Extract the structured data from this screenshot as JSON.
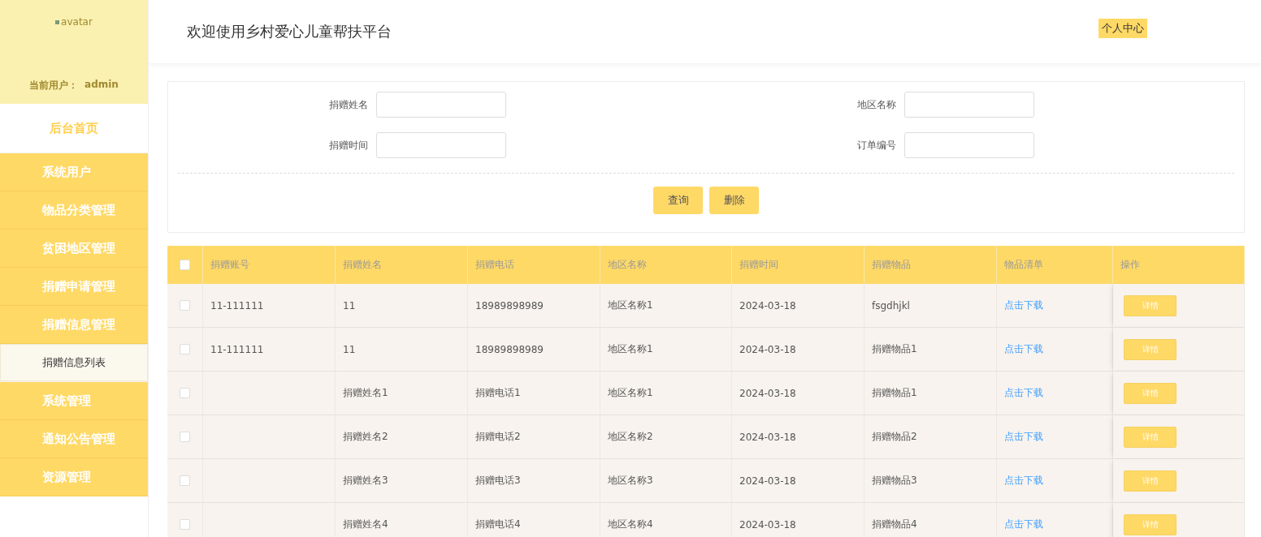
{
  "sidebar": {
    "avatar_alt": "avatar",
    "user_label": "当前用户：",
    "user_name": "admin",
    "items": [
      {
        "kind": "home",
        "label": "后台首页",
        "selected": false
      },
      {
        "kind": "menu",
        "label": "系统用户",
        "selected": false
      },
      {
        "kind": "menu",
        "label": "物品分类管理",
        "selected": false
      },
      {
        "kind": "menu",
        "label": "贫困地区管理",
        "selected": false
      },
      {
        "kind": "menu",
        "label": "捐赠申请管理",
        "selected": false
      },
      {
        "kind": "menu",
        "label": "捐赠信息管理",
        "selected": false
      },
      {
        "kind": "sub",
        "label": "捐赠信息列表",
        "selected": true
      },
      {
        "kind": "menu",
        "label": "系统管理",
        "selected": false
      },
      {
        "kind": "menu",
        "label": "通知公告管理",
        "selected": false
      },
      {
        "kind": "menu",
        "label": "资源管理",
        "selected": false
      }
    ]
  },
  "header": {
    "title": "欢迎使用乡村爱心儿童帮扶平台",
    "profile_button": "个人中心"
  },
  "filters": [
    {
      "label": "捐赠姓名"
    },
    {
      "label": "地区名称"
    },
    {
      "label": "捐赠时间"
    },
    {
      "label": "订单编号"
    }
  ],
  "actions": [
    "查询",
    "删除"
  ],
  "table": {
    "select_all_checked": false,
    "columns": [
      "捐赠账号",
      "捐赠姓名",
      "捐赠电话",
      "地区名称",
      "捐赠时间",
      "捐赠物品",
      "物品清单",
      "操作"
    ],
    "rows": [
      {
        "checked": false,
        "cells": [
          "11-111111",
          "11",
          "18989898989",
          "地区名称1",
          "2024-03-18",
          "fsgdhjkl"
        ],
        "link": "点击下载",
        "button": "详情"
      },
      {
        "checked": false,
        "cells": [
          "11-111111",
          "11",
          "18989898989",
          "地区名称1",
          "2024-03-18",
          "捐赠物品1"
        ],
        "link": "点击下载",
        "button": "详情"
      },
      {
        "checked": false,
        "cells": [
          "",
          "捐赠姓名1",
          "捐赠电话1",
          "地区名称1",
          "2024-03-18",
          "捐赠物品1"
        ],
        "link": "点击下载",
        "button": "详情"
      },
      {
        "checked": false,
        "cells": [
          "",
          "捐赠姓名2",
          "捐赠电话2",
          "地区名称2",
          "2024-03-18",
          "捐赠物品2"
        ],
        "link": "点击下载",
        "button": "详情"
      },
      {
        "checked": false,
        "cells": [
          "",
          "捐赠姓名3",
          "捐赠电话3",
          "地区名称3",
          "2024-03-18",
          "捐赠物品3"
        ],
        "link": "点击下载",
        "button": "详情"
      },
      {
        "checked": false,
        "cells": [
          "",
          "捐赠姓名4",
          "捐赠电话4",
          "地区名称4",
          "2024-03-18",
          "捐赠物品4"
        ],
        "link": "点击下载",
        "button": "详情"
      }
    ]
  }
}
